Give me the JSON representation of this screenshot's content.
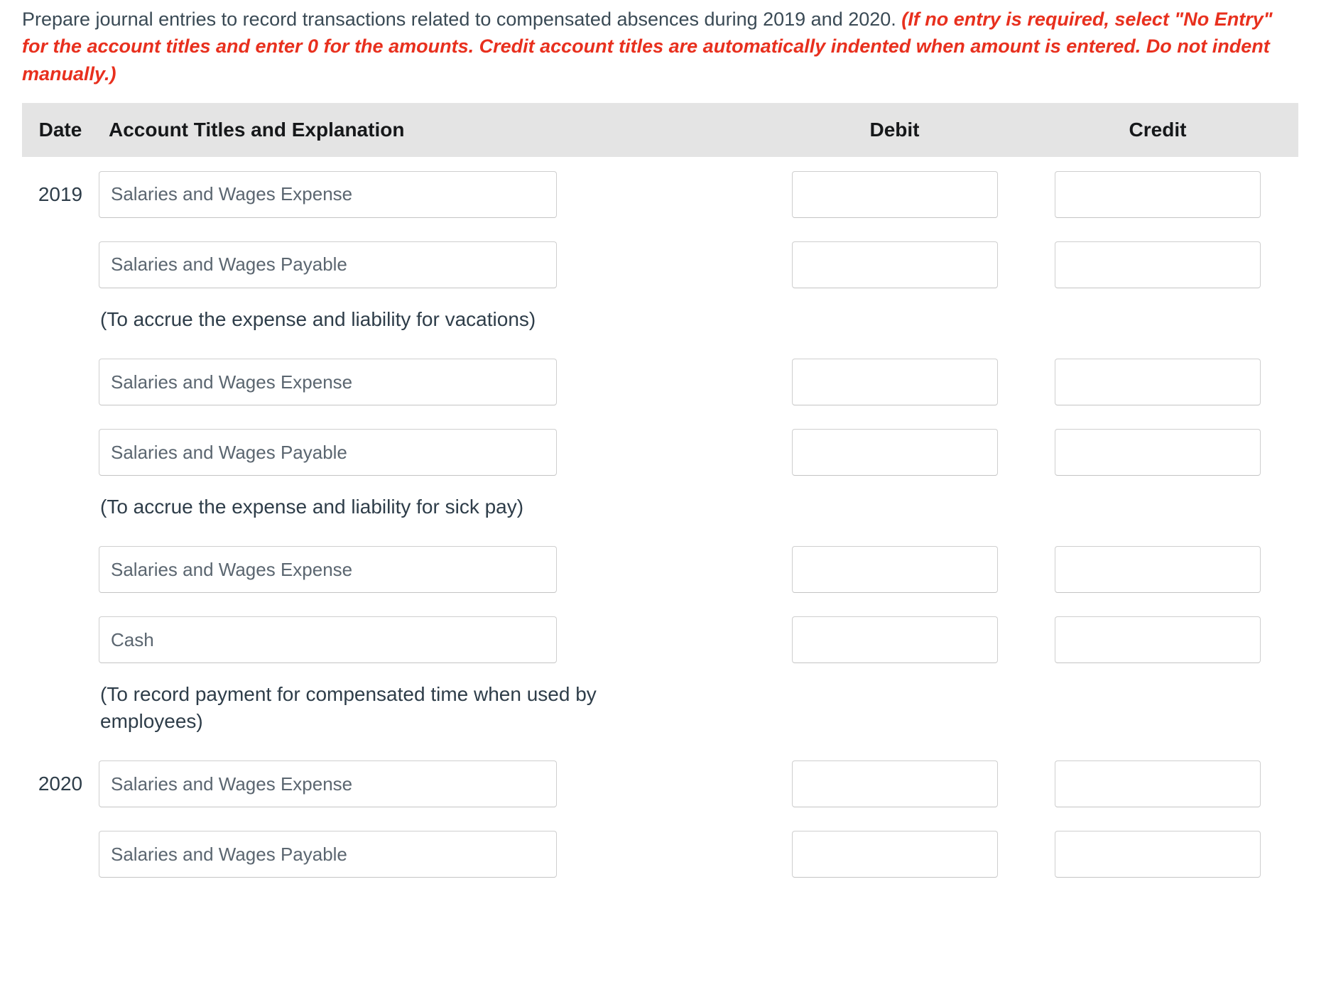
{
  "instructions": {
    "normal_text": "Prepare journal entries to record transactions related to compensated absences during 2019 and 2020. ",
    "emphasis_text": "(If no entry is required, select \"No Entry\" for the account titles and enter 0 for the amounts. Credit account titles are automatically indented when amount is entered. Do not indent manually.)",
    "emphasis_color": "#e8301e"
  },
  "table": {
    "header": {
      "date": "Date",
      "account": "Account Titles and Explanation",
      "debit": "Debit",
      "credit": "Credit"
    },
    "header_bg": "#e4e4e4",
    "rows": [
      {
        "kind": "entry",
        "date": "2019",
        "account_value": "Salaries and Wages Expense",
        "account_placeholder": "Salaries and Wages Expense",
        "debit_value": "",
        "credit_value": ""
      },
      {
        "kind": "entry",
        "date": "",
        "account_value": "Salaries and Wages Payable",
        "account_placeholder": "Salaries and Wages Payable",
        "debit_value": "",
        "credit_value": ""
      },
      {
        "kind": "note",
        "text": "(To accrue the expense and liability for vacations)"
      },
      {
        "kind": "entry",
        "date": "",
        "account_value": "Salaries and Wages Expense",
        "account_placeholder": "Salaries and Wages Expense",
        "debit_value": "",
        "credit_value": ""
      },
      {
        "kind": "entry",
        "date": "",
        "account_value": "Salaries and Wages Payable",
        "account_placeholder": "Salaries and Wages Payable",
        "debit_value": "",
        "credit_value": ""
      },
      {
        "kind": "note",
        "text": "(To accrue the expense and liability for sick pay)"
      },
      {
        "kind": "entry",
        "date": "",
        "account_value": "Salaries and Wages Expense",
        "account_placeholder": "Salaries and Wages Expense",
        "debit_value": "",
        "credit_value": ""
      },
      {
        "kind": "entry",
        "date": "",
        "account_value": "Cash",
        "account_placeholder": "Cash",
        "debit_value": "",
        "credit_value": ""
      },
      {
        "kind": "note",
        "text": "(To record payment for compensated time when used by employees)"
      },
      {
        "kind": "entry",
        "date": "2020",
        "account_value": "Salaries and Wages Expense",
        "account_placeholder": "Salaries and Wages Expense",
        "debit_value": "",
        "credit_value": ""
      },
      {
        "kind": "entry",
        "date": "",
        "account_value": "Salaries and Wages Payable",
        "account_placeholder": "Salaries and Wages Payable",
        "debit_value": "",
        "credit_value": ""
      }
    ]
  }
}
